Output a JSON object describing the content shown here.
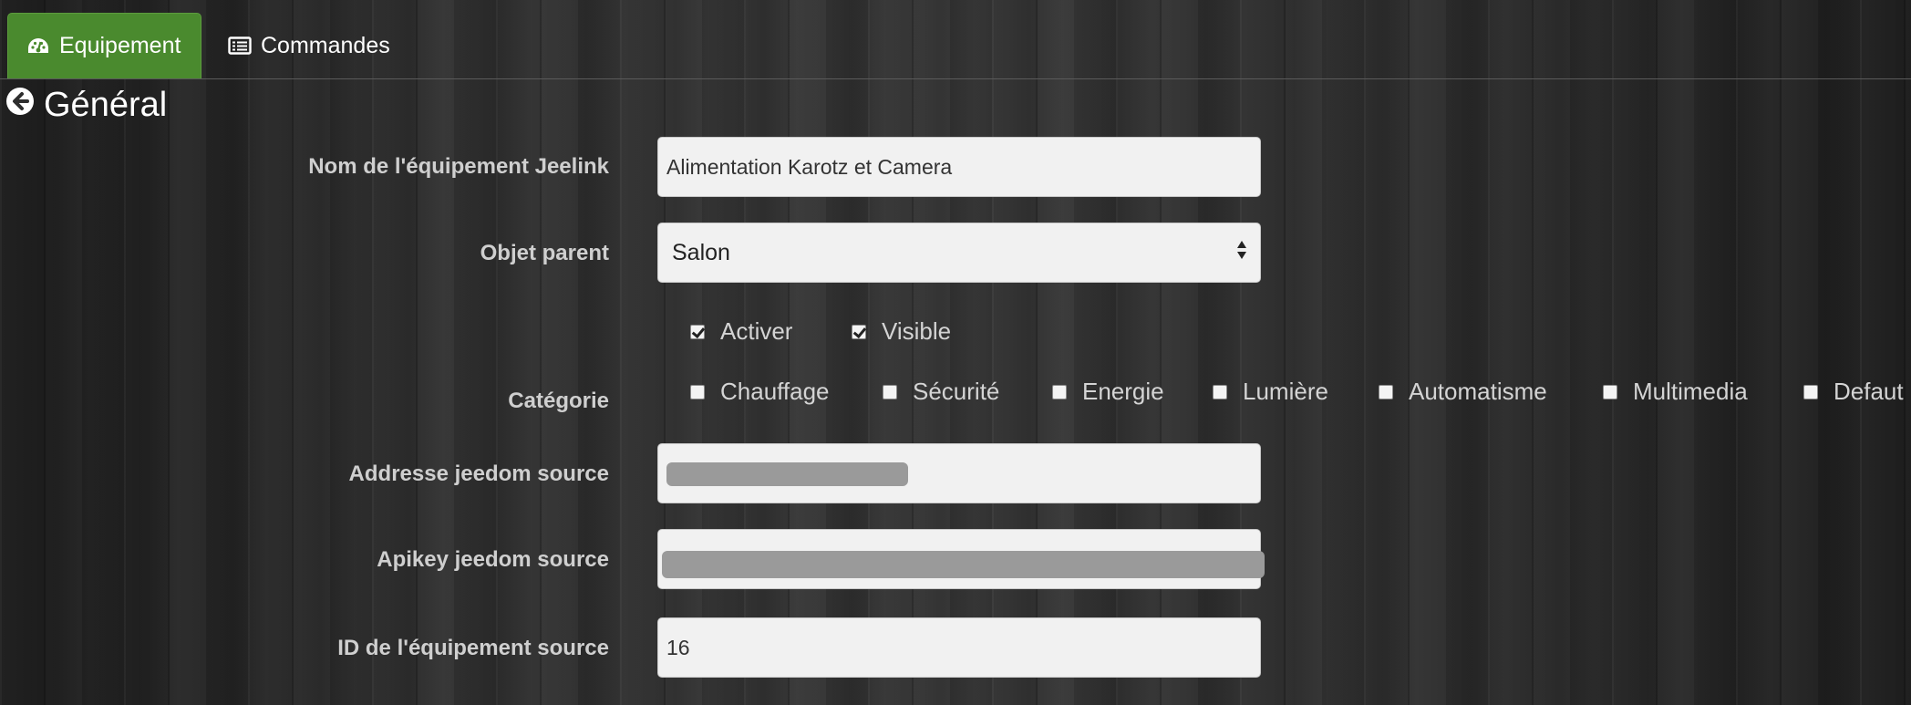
{
  "tabs": [
    {
      "label": "Equipement",
      "icon": "tachometer-icon",
      "active": true
    },
    {
      "label": "Commandes",
      "icon": "list-alt-icon",
      "active": false
    }
  ],
  "section": {
    "title": "Général",
    "icon": "arrow-circle-left-icon"
  },
  "form": {
    "name_label": "Nom de l'équipement Jeelink",
    "name_value": "Alimentation Karotz et Camera",
    "parent_label": "Objet parent",
    "parent_value": "Salon",
    "activer_label": "Activer",
    "activer_checked": true,
    "visible_label": "Visible",
    "visible_checked": true,
    "category_label": "Catégorie",
    "categories": [
      {
        "label": "Chauffage",
        "checked": false
      },
      {
        "label": "Sécurité",
        "checked": false
      },
      {
        "label": "Energie",
        "checked": false
      },
      {
        "label": "Lumière",
        "checked": false
      },
      {
        "label": "Automatisme",
        "checked": false
      },
      {
        "label": "Multimedia",
        "checked": false
      },
      {
        "label": "Defaut",
        "checked": false
      }
    ],
    "address_label": "Addresse jeedom source",
    "apikey_label": "Apikey jeedom source",
    "source_id_label": "ID de l'équipement source",
    "source_id_value": "16"
  },
  "colors": {
    "active_tab": "#4a8a2e",
    "field_background": "#f1f1f1",
    "label_text": "#cfcfcf"
  }
}
